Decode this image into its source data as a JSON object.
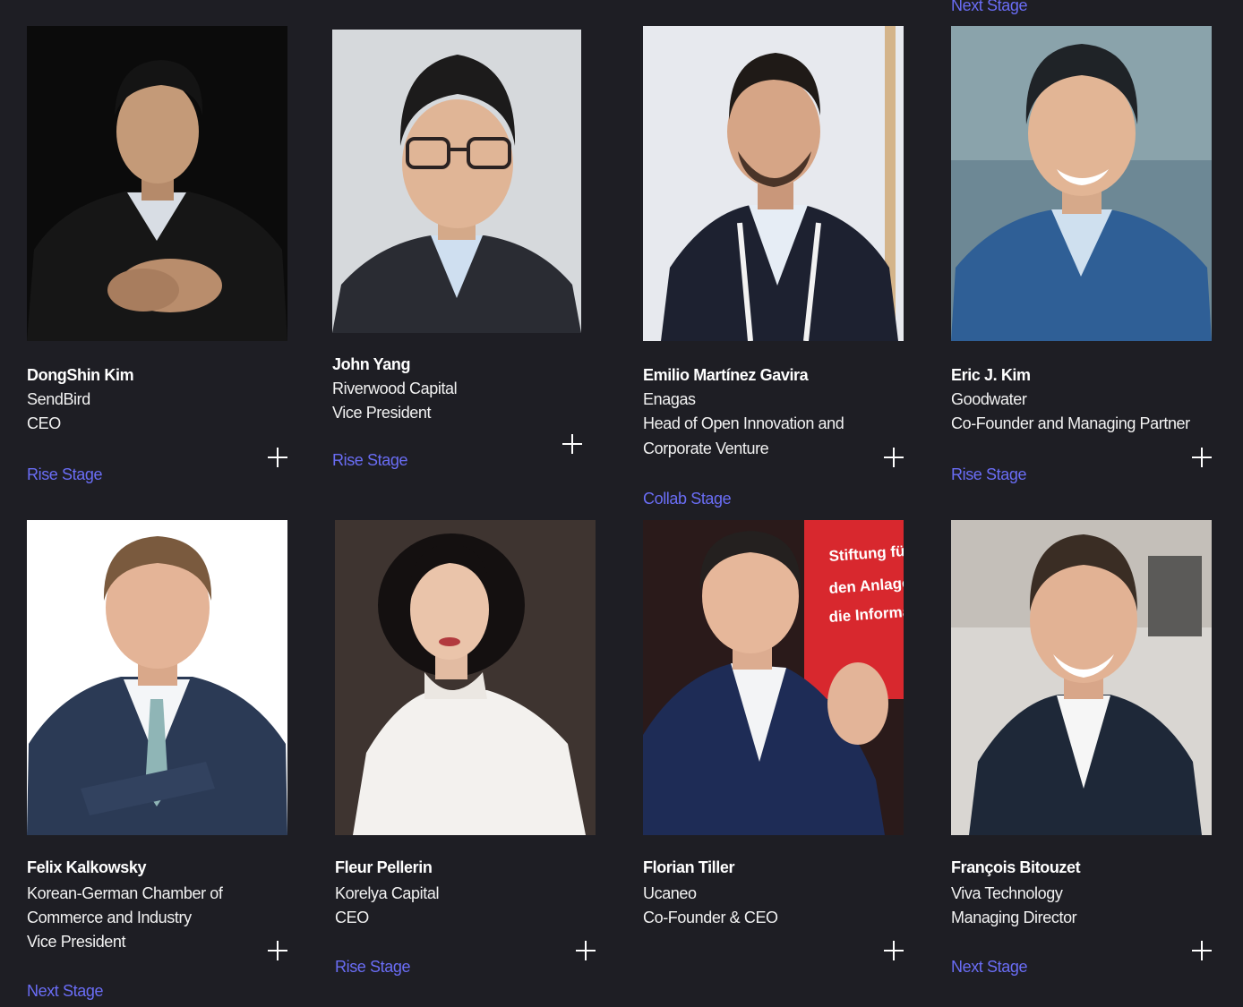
{
  "top_link": "Next Stage",
  "speakers": [
    {
      "name": "DongShin Kim",
      "lines": [
        "SendBird",
        "CEO"
      ],
      "stage": "Rise Stage"
    },
    {
      "name": "John Yang",
      "lines": [
        "Riverwood Capital",
        "Vice President"
      ],
      "stage": "Rise Stage"
    },
    {
      "name": "Emilio Martínez Gavira",
      "lines": [
        "Enagas",
        "Head of Open Innovation and",
        "Corporate Venture"
      ],
      "stage": "Collab Stage"
    },
    {
      "name": "Eric J. Kim",
      "lines": [
        "Goodwater",
        "Co-Founder and Managing Partner"
      ],
      "stage": "Rise Stage"
    },
    {
      "name": "Felix Kalkowsky",
      "lines": [
        "Korean-German Chamber of",
        "Commerce and Industry",
        "Vice President"
      ],
      "stage": "Next Stage"
    },
    {
      "name": "Fleur Pellerin",
      "lines": [
        "Korelya Capital",
        "CEO"
      ],
      "stage": "Rise Stage"
    },
    {
      "name": "Florian Tiller",
      "lines": [
        "Ucaneo",
        "Co-Founder & CEO"
      ],
      "stage": ""
    },
    {
      "name": "François Bitouzet",
      "lines": [
        "Viva Technology",
        "Managing Director"
      ],
      "stage": "Next Stage"
    }
  ],
  "photo_text": [
    "Stiftung für d",
    "den Anlagenl",
    "die Informati"
  ],
  "colors": {
    "background": "#1e1e24",
    "stage_link": "#6a6df5",
    "text": "#ffffff"
  }
}
